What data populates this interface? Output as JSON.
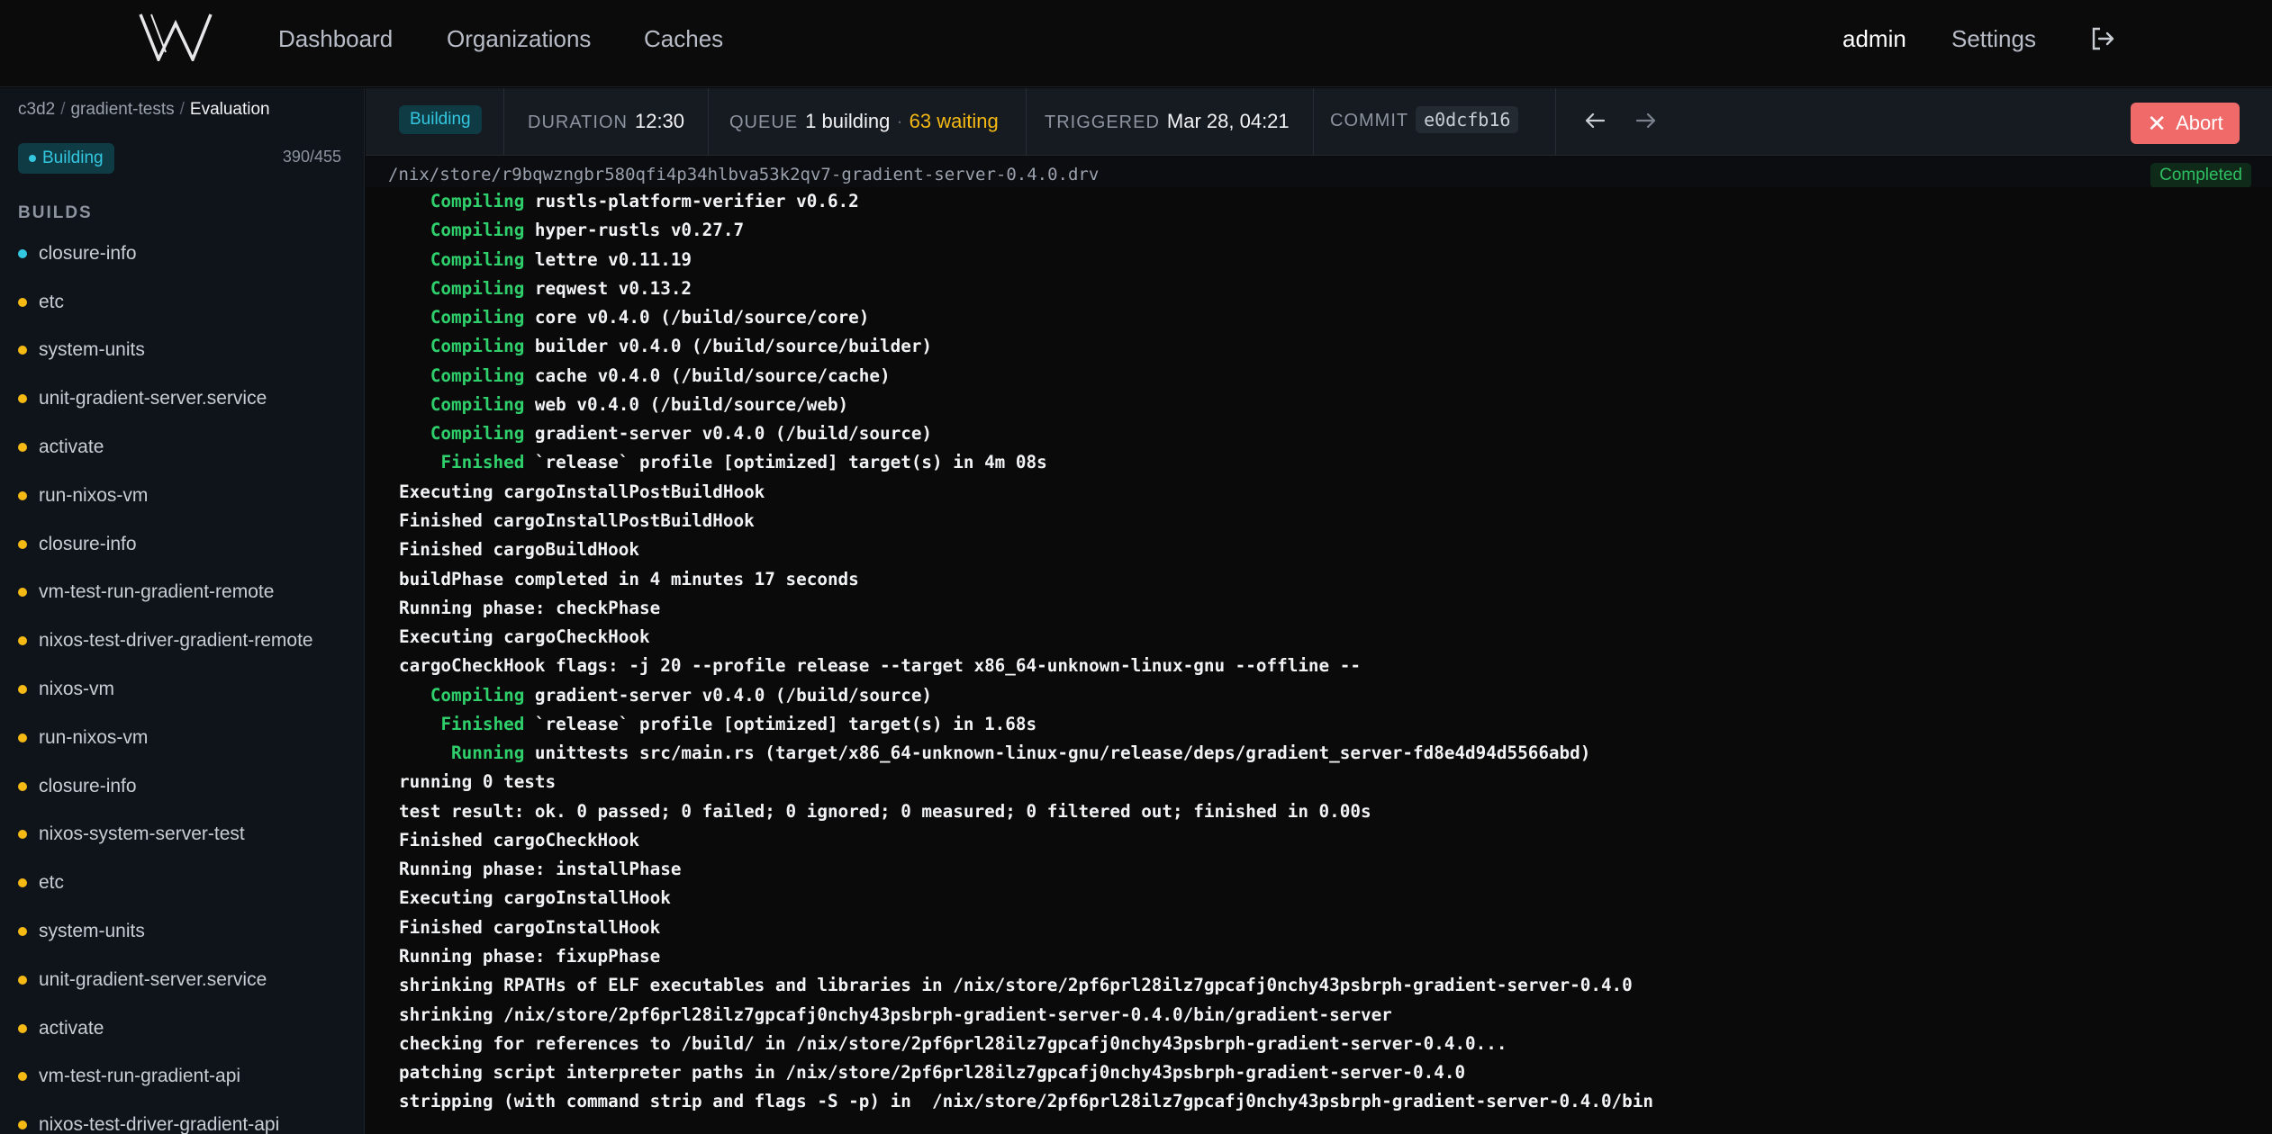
{
  "nav": {
    "links": [
      "Dashboard",
      "Organizations",
      "Caches"
    ],
    "user": "admin",
    "settings": "Settings",
    "logo_icon": "w-logo-icon",
    "logout_icon": "logout-icon"
  },
  "sidebar": {
    "breadcrumb": [
      "c3d2",
      "gradient-tests",
      "Evaluation"
    ],
    "status": "Building",
    "progress": "390/455",
    "builds_label": "BUILDS",
    "builds": [
      {
        "name": "closure-info",
        "state": "building"
      },
      {
        "name": "etc",
        "state": "queued"
      },
      {
        "name": "system-units",
        "state": "queued"
      },
      {
        "name": "unit-gradient-server.service",
        "state": "queued"
      },
      {
        "name": "activate",
        "state": "queued"
      },
      {
        "name": "run-nixos-vm",
        "state": "queued"
      },
      {
        "name": "closure-info",
        "state": "queued"
      },
      {
        "name": "vm-test-run-gradient-remote",
        "state": "queued"
      },
      {
        "name": "nixos-test-driver-gradient-remote",
        "state": "queued"
      },
      {
        "name": "nixos-vm",
        "state": "queued"
      },
      {
        "name": "run-nixos-vm",
        "state": "queued"
      },
      {
        "name": "closure-info",
        "state": "queued"
      },
      {
        "name": "nixos-system-server-test",
        "state": "queued"
      },
      {
        "name": "etc",
        "state": "queued"
      },
      {
        "name": "system-units",
        "state": "queued"
      },
      {
        "name": "unit-gradient-server.service",
        "state": "queued"
      },
      {
        "name": "activate",
        "state": "queued"
      },
      {
        "name": "vm-test-run-gradient-api",
        "state": "queued"
      },
      {
        "name": "nixos-test-driver-gradient-api",
        "state": "queued"
      }
    ]
  },
  "header": {
    "status": "Building",
    "duration_label": "DURATION",
    "duration": "12:30",
    "queue_label": "QUEUE",
    "queue_building": "1 building",
    "queue_waiting": "63 waiting",
    "triggered_label": "TRIGGERED",
    "triggered": "Mar 28, 04:21",
    "commit_label": "COMMIT",
    "commit": "e0dcfb16",
    "abort_label": "Abort"
  },
  "build_detail": {
    "path": "/nix/store/r9bqwzngbr580qfi4p34hlbva53k2qv7-gradient-server-0.4.0.drv",
    "status": "Completed"
  },
  "log": [
    {
      "indent": "   ",
      "kw": "Compiling",
      "text": " rustls-platform-verifier v0.6.2"
    },
    {
      "indent": "   ",
      "kw": "Compiling",
      "text": " hyper-rustls v0.27.7"
    },
    {
      "indent": "   ",
      "kw": "Compiling",
      "text": " lettre v0.11.19"
    },
    {
      "indent": "   ",
      "kw": "Compiling",
      "text": " reqwest v0.13.2"
    },
    {
      "indent": "   ",
      "kw": "Compiling",
      "text": " core v0.4.0 (/build/source/core)"
    },
    {
      "indent": "   ",
      "kw": "Compiling",
      "text": " builder v0.4.0 (/build/source/builder)"
    },
    {
      "indent": "   ",
      "kw": "Compiling",
      "text": " cache v0.4.0 (/build/source/cache)"
    },
    {
      "indent": "   ",
      "kw": "Compiling",
      "text": " web v0.4.0 (/build/source/web)"
    },
    {
      "indent": "   ",
      "kw": "Compiling",
      "text": " gradient-server v0.4.0 (/build/source)"
    },
    {
      "indent": "    ",
      "kw": "Finished",
      "text": " `release` profile [optimized] target(s) in 4m 08s"
    },
    {
      "indent": "",
      "kw": "",
      "text": "Executing cargoInstallPostBuildHook"
    },
    {
      "indent": "",
      "kw": "",
      "text": "Finished cargoInstallPostBuildHook"
    },
    {
      "indent": "",
      "kw": "",
      "text": "Finished cargoBuildHook"
    },
    {
      "indent": "",
      "kw": "",
      "text": "buildPhase completed in 4 minutes 17 seconds"
    },
    {
      "indent": "",
      "kw": "",
      "text": "Running phase: checkPhase"
    },
    {
      "indent": "",
      "kw": "",
      "text": "Executing cargoCheckHook"
    },
    {
      "indent": "",
      "kw": "",
      "text": "cargoCheckHook flags: -j 20 --profile release --target x86_64-unknown-linux-gnu --offline --"
    },
    {
      "indent": "   ",
      "kw": "Compiling",
      "text": " gradient-server v0.4.0 (/build/source)"
    },
    {
      "indent": "    ",
      "kw": "Finished",
      "text": " `release` profile [optimized] target(s) in 1.68s"
    },
    {
      "indent": "     ",
      "kw": "Running",
      "text": " unittests src/main.rs (target/x86_64-unknown-linux-gnu/release/deps/gradient_server-fd8e4d94d5566abd)"
    },
    {
      "indent": "",
      "kw": "",
      "text": "running 0 tests"
    },
    {
      "indent": "",
      "kw": "",
      "text": "test result: ok. 0 passed; 0 failed; 0 ignored; 0 measured; 0 filtered out; finished in 0.00s"
    },
    {
      "indent": "",
      "kw": "",
      "text": "Finished cargoCheckHook"
    },
    {
      "indent": "",
      "kw": "",
      "text": "Running phase: installPhase"
    },
    {
      "indent": "",
      "kw": "",
      "text": "Executing cargoInstallHook"
    },
    {
      "indent": "",
      "kw": "",
      "text": "Finished cargoInstallHook"
    },
    {
      "indent": "",
      "kw": "",
      "text": "Running phase: fixupPhase"
    },
    {
      "indent": "",
      "kw": "",
      "text": "shrinking RPATHs of ELF executables and libraries in /nix/store/2pf6prl28ilz7gpcafj0nchy43psbrph-gradient-server-0.4.0"
    },
    {
      "indent": "",
      "kw": "",
      "text": "shrinking /nix/store/2pf6prl28ilz7gpcafj0nchy43psbrph-gradient-server-0.4.0/bin/gradient-server"
    },
    {
      "indent": "",
      "kw": "",
      "text": "checking for references to /build/ in /nix/store/2pf6prl28ilz7gpcafj0nchy43psbrph-gradient-server-0.4.0..."
    },
    {
      "indent": "",
      "kw": "",
      "text": "patching script interpreter paths in /nix/store/2pf6prl28ilz7gpcafj0nchy43psbrph-gradient-server-0.4.0"
    },
    {
      "indent": "",
      "kw": "",
      "text": "stripping (with command strip and flags -S -p) in  /nix/store/2pf6prl28ilz7gpcafj0nchy43psbrph-gradient-server-0.4.0/bin"
    }
  ],
  "colors": {
    "accent_cyan": "#33c7e0",
    "queued_yellow": "#f5b914",
    "success_green": "#2fd06b",
    "abort_red": "#f06a6a"
  }
}
